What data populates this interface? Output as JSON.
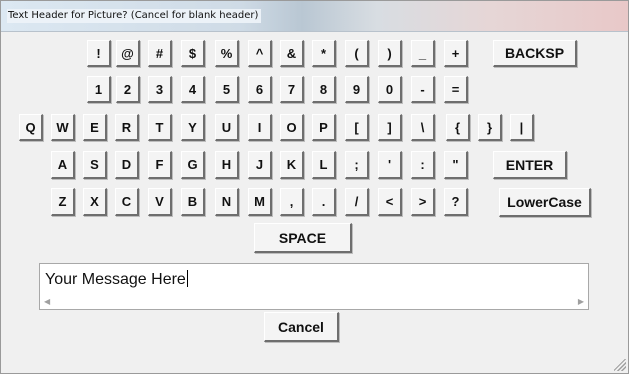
{
  "window": {
    "title": "Text Header for Picture? (Cancel for blank header)"
  },
  "keyboard": {
    "row1": [
      "!",
      "@",
      "#",
      "$",
      "%",
      "^",
      "&",
      "*",
      "(",
      ")",
      "_",
      "+"
    ],
    "row1_special": "BACKSP",
    "row2": [
      "1",
      "2",
      "3",
      "4",
      "5",
      "6",
      "7",
      "8",
      "9",
      "0",
      "-",
      "="
    ],
    "row3": [
      "Q",
      "W",
      "E",
      "R",
      "T",
      "Y",
      "U",
      "I",
      "O",
      "P",
      "[",
      "]",
      "\\",
      "{",
      "}",
      "|"
    ],
    "row4": [
      "A",
      "S",
      "D",
      "F",
      "G",
      "H",
      "J",
      "K",
      "L",
      ";",
      "'",
      ":",
      "\""
    ],
    "row4_special": "ENTER",
    "row5": [
      "Z",
      "X",
      "C",
      "V",
      "B",
      "N",
      "M",
      ",",
      ".",
      "/",
      "<",
      ">",
      "?"
    ],
    "row5_special": "LowerCase",
    "space_label": "SPACE"
  },
  "message": {
    "value": "Your Message Here",
    "scroll_left_icon": "scroll-left-arrow-icon",
    "scroll_right_icon": "scroll-right-arrow-icon"
  },
  "cancel_label": "Cancel",
  "colors": {
    "key_face": "#f4f4f4",
    "key_shadow": "#6e6e6e",
    "dialog_bg": "#f0f0f0",
    "input_bg": "#ffffff"
  }
}
